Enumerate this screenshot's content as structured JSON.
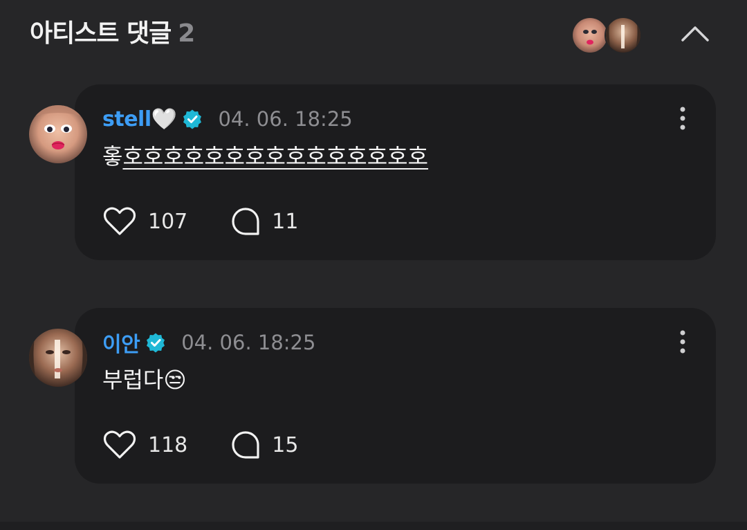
{
  "header": {
    "title": "아티스트 댓글",
    "count": "2",
    "collapse_icon": "chevron-up-icon"
  },
  "colors": {
    "background": "#262628",
    "bubble": "#1c1c1e",
    "author": "#3d9df5",
    "verified": "#1fb8d6",
    "timestamp": "#8e8e92"
  },
  "comments": [
    {
      "author": "stell🤍",
      "timestamp": "04. 06. 18:25",
      "text_first": "홓",
      "text_rest": "호호호호호호호호호호호호호호호",
      "likes": "107",
      "replies": "11"
    },
    {
      "author": "이안",
      "timestamp": "04. 06. 18:25",
      "text_first": "부럽다😒",
      "text_rest": "",
      "likes": "118",
      "replies": "15"
    }
  ]
}
